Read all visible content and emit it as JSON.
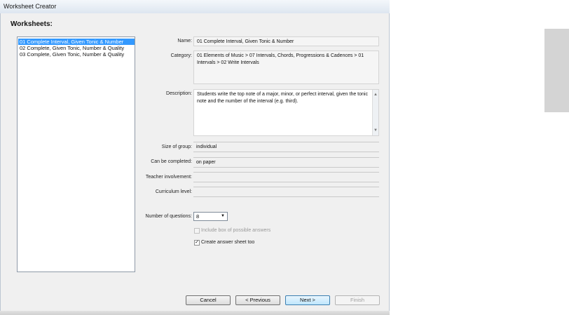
{
  "window": {
    "title": "Worksheet Creator"
  },
  "worksheets": {
    "heading": "Worksheets:",
    "items": [
      {
        "label": "01 Complete Interval, Given Tonic & Number"
      },
      {
        "label": "02 Complete, Given Tonic, Number & Quality"
      },
      {
        "label": "03 Complete, Given Tonic, Number & Quality"
      }
    ],
    "selected_index": 0
  },
  "details": {
    "name_label": "Name:",
    "name_value": "01 Complete Interval, Given Tonic & Number",
    "category_label": "Category:",
    "category_value": "01 Elements of Music > 07 Intervals, Chords, Progressions & Cadences > 01 Intervals > 02 Write Intervals",
    "description_label": "Description:",
    "description_value": "Students write the top note of a major, minor, or perfect interval, given the tonic note and the number of the interval (e.g. third).",
    "size_label": "Size of group:",
    "size_value": "individual",
    "completed_label": "Can be completed:",
    "completed_value": "on paper",
    "teacher_label": "Teacher involvement:",
    "teacher_value": "",
    "curriculum_label": "Curriculum level:",
    "curriculum_value": ""
  },
  "options": {
    "questions_label": "Number of questions:",
    "questions_value": "8",
    "include_box_label": "Include box of possible answers",
    "include_box_checked": false,
    "include_box_enabled": false,
    "answer_sheet_label": "Create answer sheet too",
    "answer_sheet_checked": true
  },
  "buttons": {
    "cancel": "Cancel",
    "previous": "< Previous",
    "next": "Next >",
    "finish": "Finish"
  },
  "icons": {
    "dropdown": "chevron-down-icon",
    "scroll_up": "scroll-up-arrow-icon",
    "scroll_down": "scroll-down-arrow-icon",
    "check": "checkmark-icon"
  },
  "colors": {
    "selection": "#3399ff",
    "default_button": "#bee6fd"
  }
}
